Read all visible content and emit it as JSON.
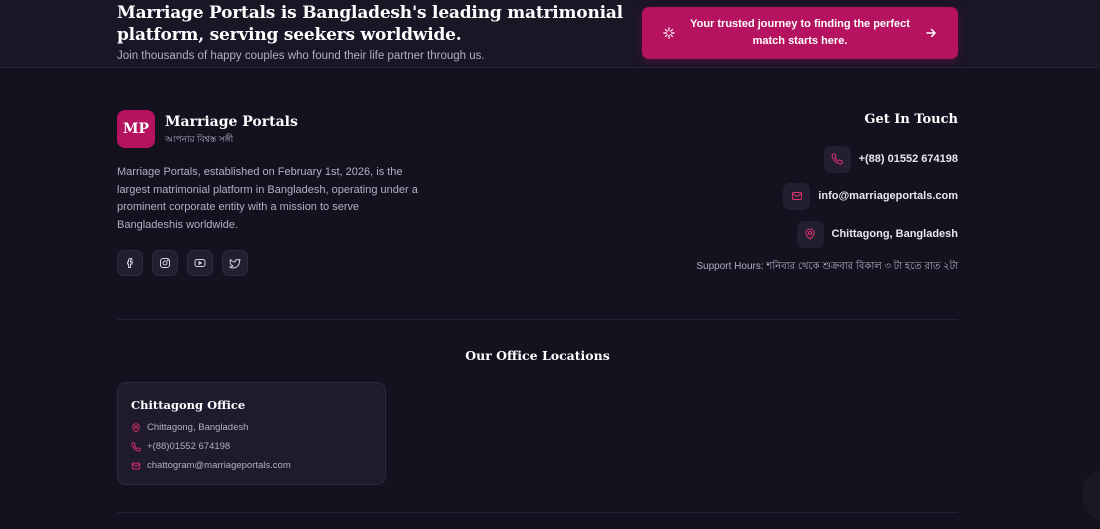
{
  "hero": {
    "title": "Marriage Portals is Bangladesh's leading matrimonial platform, serving seekers worldwide.",
    "subtitle": "Join thousands of happy couples who found their life partner through us.",
    "cta_label": "Your trusted journey to finding the perfect match starts here."
  },
  "brand": {
    "logo_text": "MP",
    "name": "Marriage Portals",
    "tagline": "আপনার বিশ্বস্ত সঙ্গী",
    "about": "Marriage Portals, established on February 1st, 2026, is the largest matrimonial platform in Bangladesh, operating under a prominent corporate entity with a mission to serve Bangladeshis worldwide."
  },
  "socials": [
    "facebook-icon",
    "instagram-icon",
    "youtube-icon",
    "twitter-icon"
  ],
  "contact": {
    "title": "Get In Touch",
    "phone": "+(88) 01552 674198",
    "email": "info@marriageportals.com",
    "location": "Chittagong, Bangladesh",
    "support": "Support Hours: শনিবার থেকে শুক্রবার বিকাল ৩ টা হতে রাত ২টা"
  },
  "offices": {
    "heading": "Our Office Locations",
    "items": [
      {
        "name": "Chittagong Office",
        "address": "Chittagong, Bangladesh",
        "phone": "+(88)01552 674198",
        "email": "chattogram@marriageportals.com"
      }
    ]
  },
  "colors": {
    "background": "#15121f",
    "accent": "#b5125f",
    "card": "#1f1b2c",
    "muted_text": "#b3afc2"
  }
}
